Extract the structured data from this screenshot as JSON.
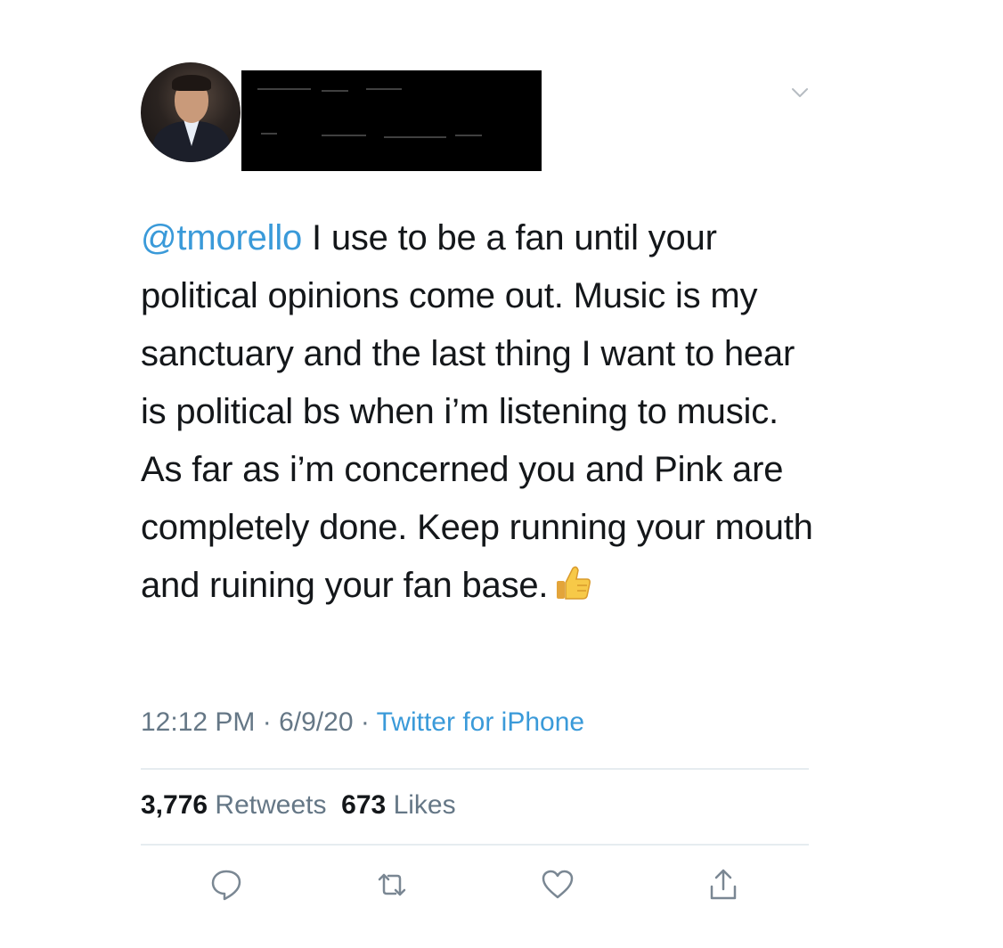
{
  "header_fragment": "…g… … … …y…",
  "tweet": {
    "mention": "@tmorello",
    "text": " I use to be a fan until your political opinions come out. Music is my sanctuary and the last thing I want to hear is political bs when i’m listening to music. As far as i’m concerned you and Pink are completely done. Keep running your mouth and ruining your fan base.",
    "time": "12:12 PM",
    "separator": " · ",
    "date": "6/9/20",
    "source": "Twitter for iPhone",
    "retweets_count": "3,776",
    "retweets_label": "Retweets",
    "likes_count": "673",
    "likes_label": "Likes"
  },
  "icons": {
    "more": "chevron-down-icon",
    "reply": "reply-icon",
    "retweet": "retweet-icon",
    "like": "heart-icon",
    "share": "share-icon",
    "emoji": "thumbs-up-emoji"
  },
  "colors": {
    "link": "#3a9ad9",
    "text": "#14171a",
    "muted": "#657786",
    "icon": "#7a8793",
    "divider": "#e6ecf0"
  }
}
